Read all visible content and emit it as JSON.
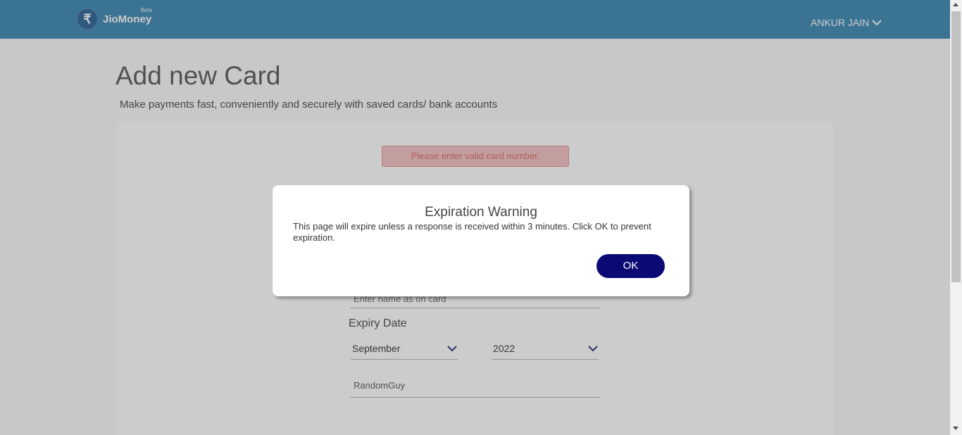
{
  "header": {
    "logo_symbol": "₹",
    "logo_text": "JioMoney",
    "logo_beta": "Beta",
    "user_name": "ANKUR JAIN",
    "bg_color": "#4a90b8"
  },
  "page": {
    "title": "Add new Card",
    "subtitle": "Make payments fast, conveniently and securely with saved cards/ bank accounts"
  },
  "form": {
    "error_message": "Please enter valid card number.",
    "name_placeholder": "Enter name as on card",
    "expiry_label": "Expiry Date",
    "month_value": "September",
    "year_value": "2022",
    "nickname_value": "RandomGuy"
  },
  "modal": {
    "title": "Expiration Warning",
    "message": "This page will expire unless a response is received within 3 minutes. Click OK to prevent expiration.",
    "ok_label": "OK",
    "ok_color": "#0b0a75"
  }
}
